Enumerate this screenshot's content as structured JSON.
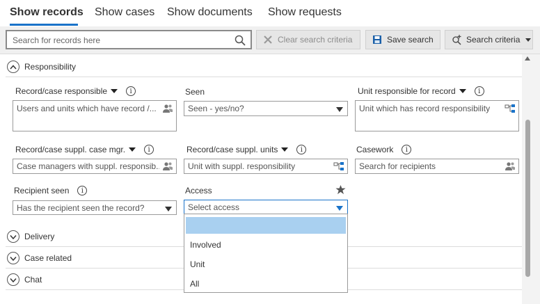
{
  "tabs": [
    {
      "label": "Show records",
      "active": true
    },
    {
      "label": "Show cases"
    },
    {
      "label": "Show documents"
    },
    {
      "label": "Show requests"
    }
  ],
  "toolbar": {
    "search_placeholder": "Search for records here",
    "clear_label": "Clear search criteria",
    "save_label": "Save search",
    "criteria_label": "Search criteria"
  },
  "sections": {
    "responsibility": "Responsibility",
    "delivery": "Delivery",
    "case_related": "Case related",
    "chat": "Chat"
  },
  "fields": {
    "record_case_responsible": {
      "label": "Record/case responsible",
      "placeholder": "Users and units which have record /..."
    },
    "seen": {
      "label": "Seen",
      "placeholder": "Seen - yes/no?"
    },
    "unit_responsible": {
      "label": "Unit responsible for record",
      "placeholder": "Unit which has record responsibility"
    },
    "suppl_case_mgr": {
      "label": "Record/case suppl. case mgr.",
      "placeholder": "Case managers with suppl. responsib..."
    },
    "suppl_units": {
      "label": "Record/case suppl. units",
      "placeholder": "Unit with suppl. responsibility"
    },
    "casework": {
      "label": "Casework",
      "placeholder": "Search for recipients"
    },
    "recipient_seen": {
      "label": "Recipient seen",
      "placeholder": "Has the recipient seen the record?"
    },
    "access": {
      "label": "Access",
      "placeholder": "Select access"
    }
  },
  "access_options": [
    "",
    "Involved",
    "Unit",
    "All"
  ],
  "info_glyph": "i",
  "colors": {
    "accent": "#1a73c9",
    "selected_option": "#a9d0f0",
    "toolbar_bg": "#f0f0f0"
  }
}
